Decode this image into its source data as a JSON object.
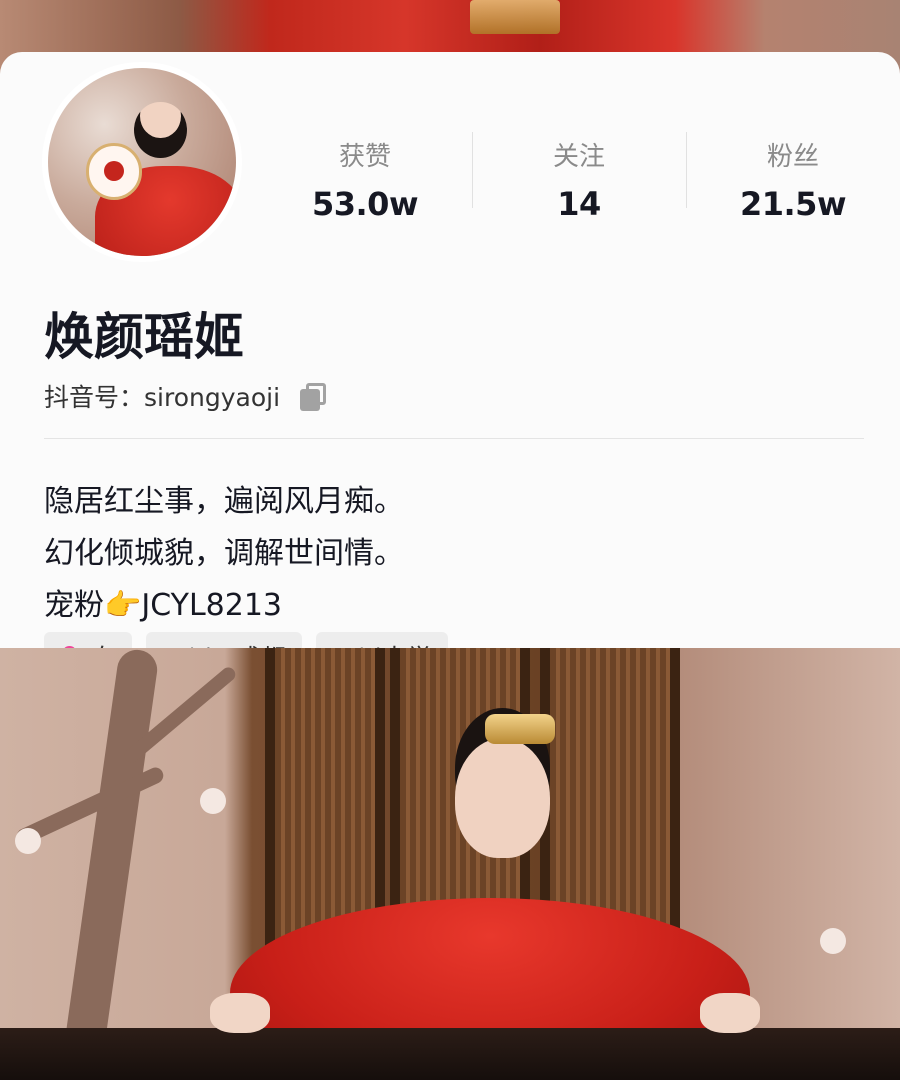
{
  "stats": [
    {
      "label": "获赞",
      "value": "53.0w"
    },
    {
      "label": "关注",
      "value": "14"
    },
    {
      "label": "粉丝",
      "value": "21.5w"
    }
  ],
  "profile": {
    "name": "焕颜瑶姬",
    "account_label": "抖音号：sirongyaoji",
    "copy_icon": "copy-icon"
  },
  "bio": {
    "line1": "隐居红尘事，遍阅风月痴。",
    "line2": "幻化倾城貌，调解世间情。",
    "line3": "宠粉👉JCYL8213"
  },
  "tags": {
    "gender": "女",
    "gender_icon": "♀",
    "location": "四川 · 成都",
    "school": "四川大学"
  },
  "colors": {
    "text": "#161823",
    "muted": "#8a8a8a",
    "tag_bg": "#ededed",
    "female": "#f0469a"
  }
}
